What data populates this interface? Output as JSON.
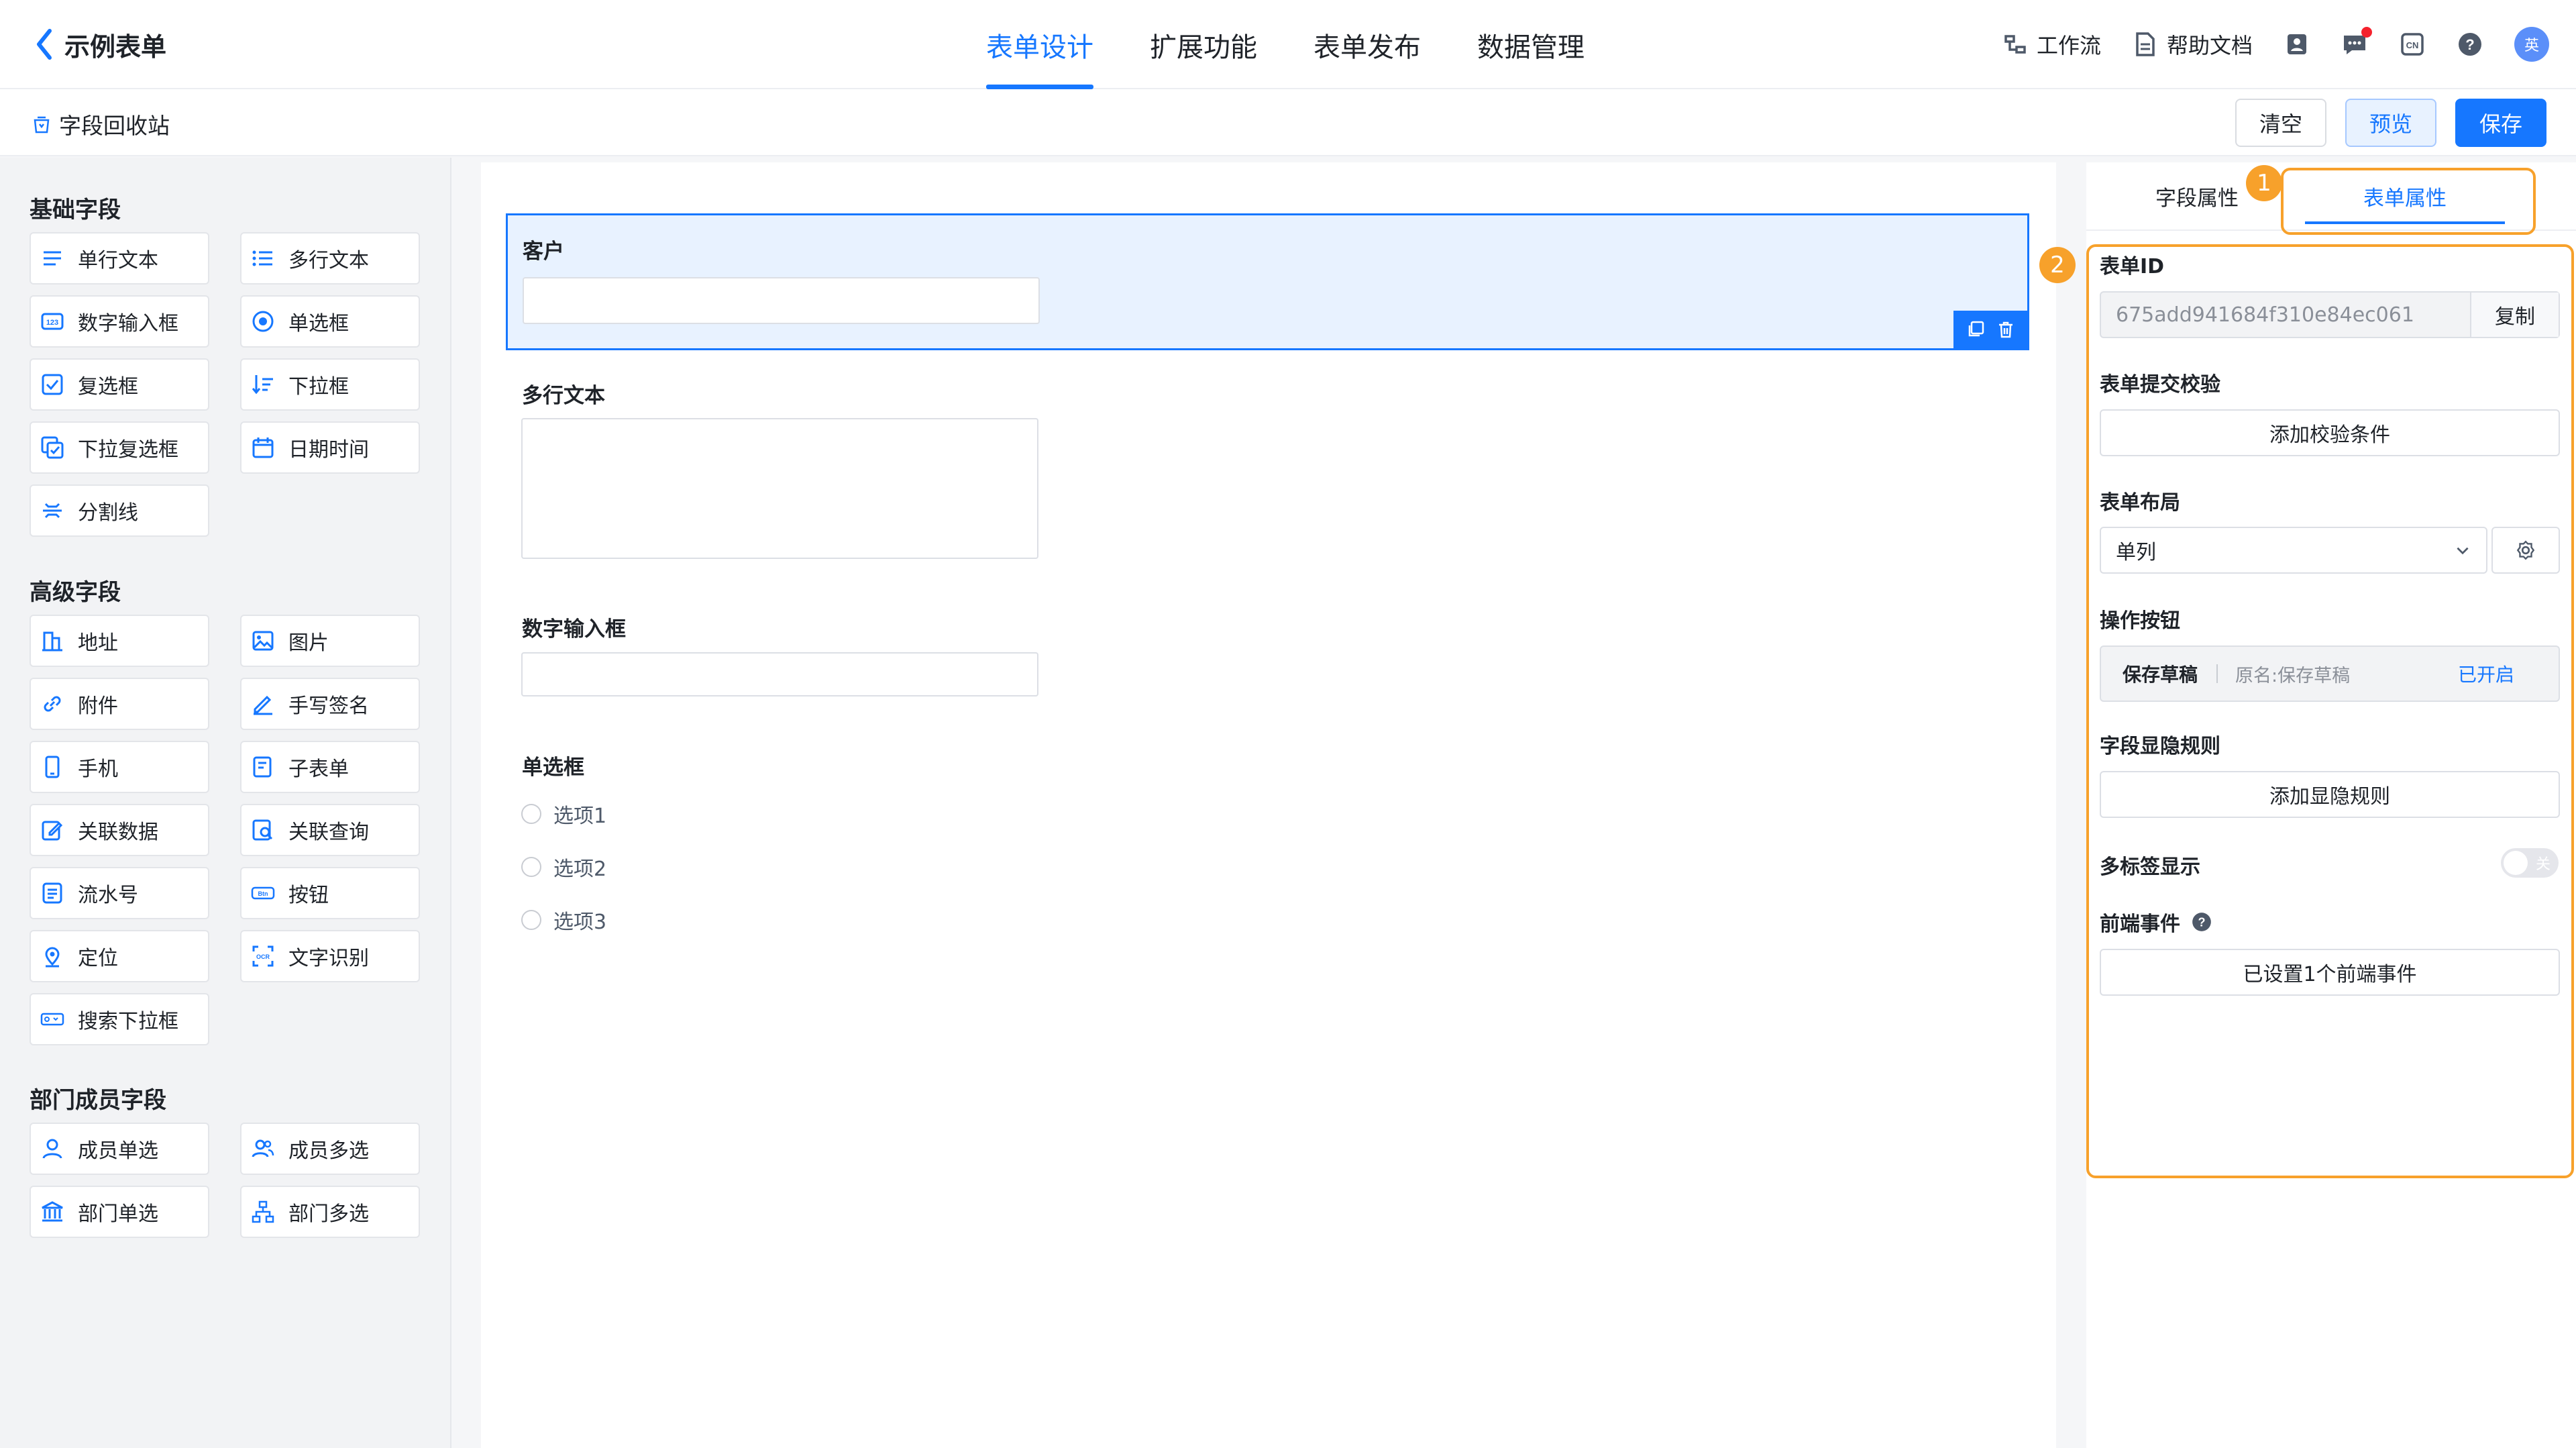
{
  "header": {
    "back_label": "示例表单",
    "tabs": [
      "表单设计",
      "扩展功能",
      "表单发布",
      "数据管理"
    ],
    "active_tab": "表单设计",
    "tools": {
      "workflow": "工作流",
      "help_docs": "帮助文档",
      "lang": "CN",
      "help": "?",
      "avatar": "英"
    }
  },
  "subbar": {
    "recycle_label": "字段回收站",
    "clear_label": "清空",
    "preview_label": "预览",
    "save_label": "保存"
  },
  "palette": {
    "basic_title": "基础字段",
    "basic": [
      "单行文本",
      "多行文本",
      "数字输入框",
      "单选框",
      "复选框",
      "下拉框",
      "下拉复选框",
      "日期时间",
      "分割线"
    ],
    "advanced_title": "高级字段",
    "advanced": [
      "地址",
      "图片",
      "附件",
      "手写签名",
      "手机",
      "子表单",
      "关联数据",
      "关联查询",
      "流水号",
      "按钮",
      "定位",
      "文字识别",
      "搜索下拉框"
    ],
    "member_title": "部门成员字段",
    "member": [
      "成员单选",
      "成员多选",
      "部门单选",
      "部门多选"
    ]
  },
  "canvas": {
    "f1_label": "客户",
    "f2_label": "多行文本",
    "f3_label": "数字输入框",
    "f4_label": "单选框",
    "radio_options": [
      "选项1",
      "选项2",
      "选项3"
    ]
  },
  "props": {
    "tab_field": "字段属性",
    "tab_form": "表单属性",
    "badge1": "1",
    "badge2": "2",
    "form_id_label": "表单ID",
    "form_id_value": "675add941684f310e84ec061",
    "copy_label": "复制",
    "submit_check_label": "表单提交校验",
    "add_check_btn": "添加校验条件",
    "layout_label": "表单布局",
    "layout_value": "单列",
    "op_buttons_label": "操作按钮",
    "op_btn_name": "保存草稿",
    "op_btn_orig": "原名:保存草稿",
    "op_btn_status": "已开启",
    "visibility_label": "字段显隐规则",
    "add_visibility_btn": "添加显隐规则",
    "multi_tab_label": "多标签显示",
    "toggle_text": "关",
    "frontend_label": "前端事件",
    "frontend_btn": "已设置1个前端事件"
  },
  "colors": {
    "primary": "#1677ff",
    "highlight": "#f7a12b"
  }
}
